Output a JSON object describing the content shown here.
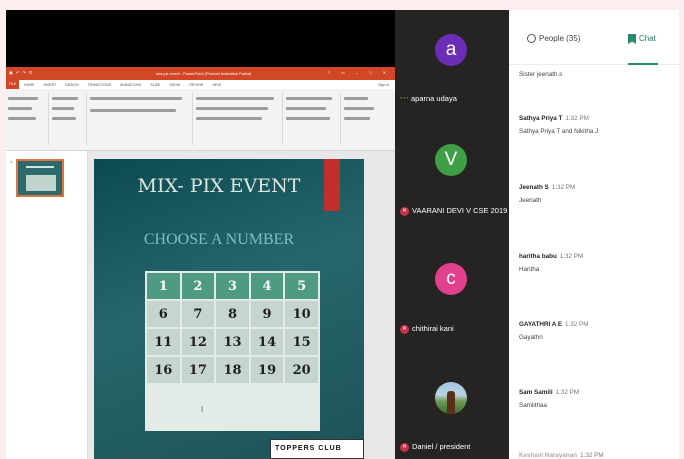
{
  "presentation": {
    "window_title": "mix-pix event - PowerPoint (Product Activation Failed)",
    "tabs": [
      "HOME",
      "INSERT",
      "DESIGN",
      "TRANSITIONS",
      "ANIMATIONS",
      "SLIDE SHOW",
      "REVIEW",
      "VIEW"
    ],
    "file_tab": "FILE",
    "sign_in": "Sign in",
    "slide_number": "1",
    "slide": {
      "title": "MIX- PIX EVENT",
      "subtitle": "CHOOSE A NUMBER",
      "grid": [
        [
          "1",
          "2",
          "3",
          "4",
          "5"
        ],
        [
          "6",
          "7",
          "8",
          "9",
          "10"
        ],
        [
          "11",
          "12",
          "13",
          "14",
          "15"
        ],
        [
          "16",
          "17",
          "18",
          "19",
          "20"
        ]
      ],
      "logo_text": "TOPPERS CLUB"
    }
  },
  "participants": [
    {
      "initial": "a",
      "name": "aparna udaya",
      "color": "#6a2db5",
      "mic": false
    },
    {
      "initial": "V",
      "name": "VAARANI DEVI V CSE 2019",
      "color": "#3f9e46",
      "mic": true
    },
    {
      "initial": "c",
      "name": "chithirai kani",
      "color": "#e0408c",
      "mic": true
    },
    {
      "initial": "",
      "name": "Daniel / president",
      "color": "#6f9a55",
      "mic": true
    }
  ],
  "panel": {
    "people_label": "People (35)",
    "chat_label": "Chat",
    "messages": [
      {
        "author": "",
        "time": "",
        "text": "Sister jeenath.s"
      },
      {
        "author": "Sathya Priya T",
        "time": "1:32 PM",
        "text": "Sathya Priya T and Nikitha J"
      },
      {
        "author": "Jeenath S",
        "time": "1:32 PM",
        "text": "Jeenath"
      },
      {
        "author": "haritha babu",
        "time": "1:32 PM",
        "text": "Haritha"
      },
      {
        "author": "GAYATHRI A E",
        "time": "1:32 PM",
        "text": "Gayathri"
      },
      {
        "author": "Sam Samili",
        "time": "1:32 PM",
        "text": "Samiithaa"
      },
      {
        "author": "Keshavi Narayanan",
        "time": "1:32 PM",
        "text": ""
      }
    ]
  }
}
